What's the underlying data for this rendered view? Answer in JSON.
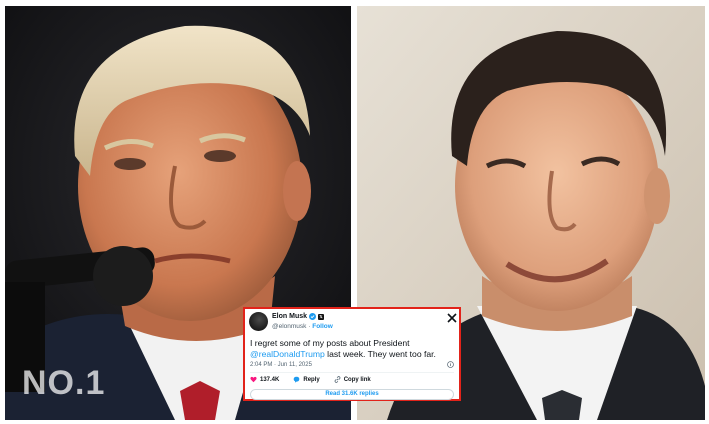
{
  "watermark": "NO.1",
  "tweet": {
    "name": "Elon Musk",
    "handle": "@elonmusk",
    "separator": "·",
    "follow_label": "Follow",
    "text_before": "I regret some of my posts about President ",
    "mention": "@realDonaldTrump",
    "text_after": " last week. They went too far.",
    "timestamp": "2:04 PM · Jun 11, 2025",
    "likes": "137.4K",
    "reply_label": "Reply",
    "copy_link_label": "Copy link",
    "read_replies": "Read 31.6K replies"
  },
  "colors": {
    "highlight_border": "#e2231a",
    "twitter_blue": "#1d9bf0",
    "like_red": "#f91880"
  },
  "icons": [
    "x-logo-icon",
    "verified-badge-icon",
    "info-icon",
    "heart-icon",
    "reply-icon",
    "link-icon"
  ]
}
